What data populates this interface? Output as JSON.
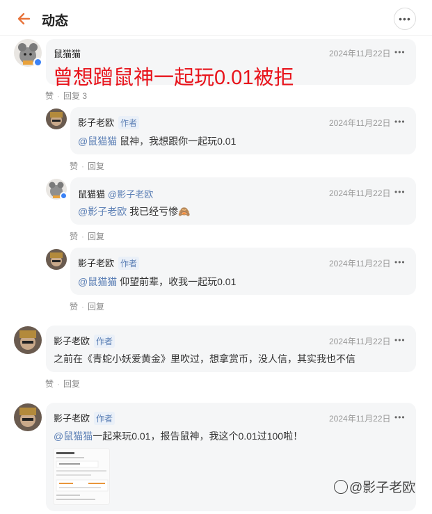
{
  "header": {
    "title": "动态",
    "back_icon": "arrow-left-icon",
    "more_icon": "more-horizontal-icon",
    "accent": "#e8743b"
  },
  "comments": [
    {
      "author": "鼠猫猫",
      "time": "2024年11月22日",
      "text": "曾想蹭鼠神一起玩0.01被拒",
      "like": "赞",
      "reply": "回复 3"
    },
    {
      "author": "影子老欧",
      "tag": "作者",
      "time": "2024年11月22日",
      "mention": "@鼠猫猫",
      "text": " 鼠神，我想跟你一起玩0.01",
      "like": "赞",
      "reply": "回复"
    },
    {
      "author": "鼠猫猫",
      "reply_to": "@影子老欧",
      "time": "2024年11月22日",
      "mention": "@影子老欧",
      "text": " 我已经亏惨🙈",
      "like": "赞",
      "reply": "回复"
    },
    {
      "author": "影子老欧",
      "tag": "作者",
      "time": "2024年11月22日",
      "mention": "@鼠猫猫",
      "text": " 仰望前辈，收我一起玩0.01",
      "like": "赞",
      "reply": "回复"
    },
    {
      "author": "影子老欧",
      "tag": "作者",
      "time": "2024年11月22日",
      "text": "之前在《青蛇小妖爱黄金》里吹过，想拿赏币，没人信，其实我也不信",
      "like": "赞",
      "reply": "回复"
    },
    {
      "author": "影子老欧",
      "tag": "作者",
      "time": "2024年11月22日",
      "mention": "@鼠猫猫",
      "text": "一起来玩0.01，报告鼠神，我这个0.01过100啦！"
    }
  ],
  "more_dots": "•••",
  "separator": "·",
  "watermark": "@影子老欧",
  "colors": {
    "mention": "#5b7fb5",
    "highlight_text": "#e8131b",
    "bubble": "#f5f6f7"
  }
}
